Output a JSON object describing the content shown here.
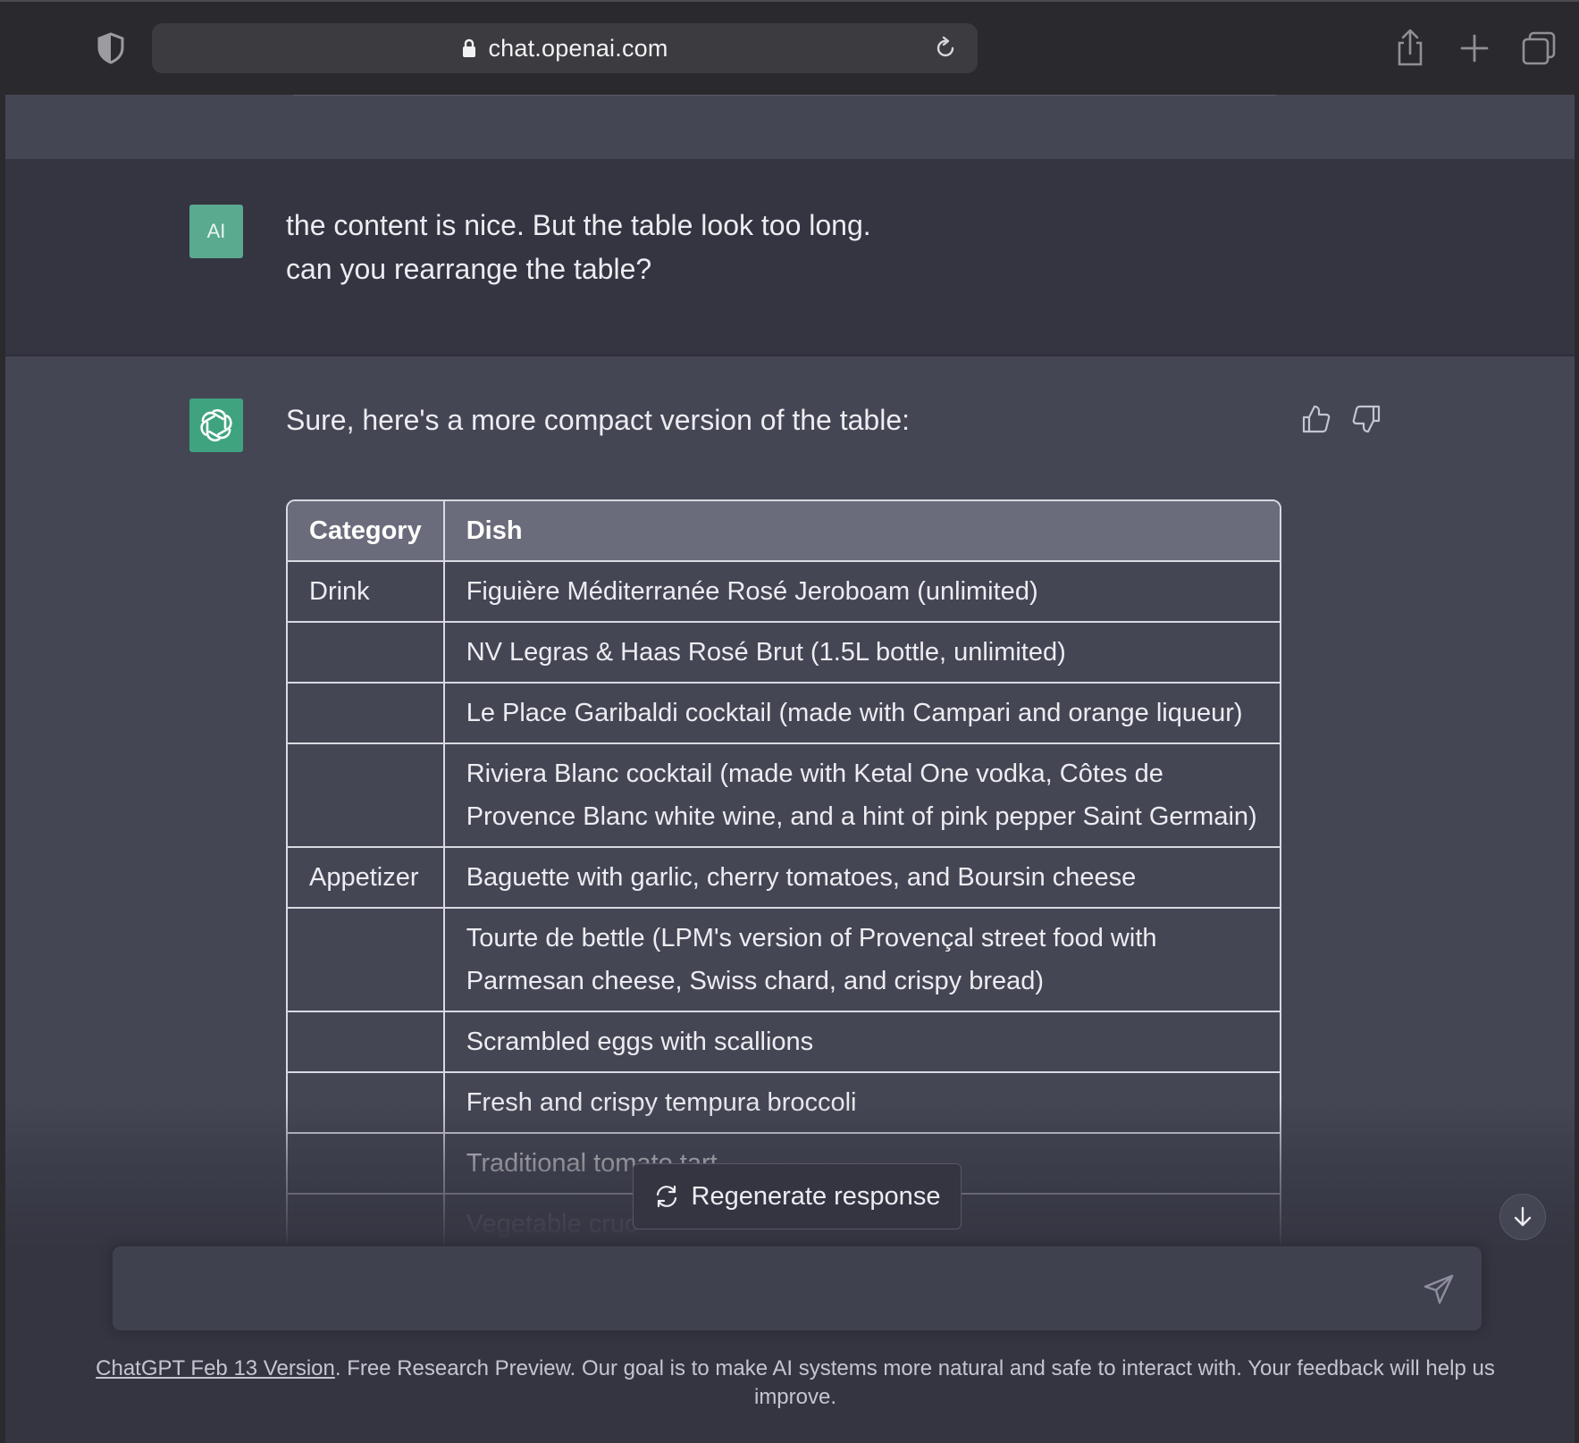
{
  "browser": {
    "url": "chat.openai.com"
  },
  "user_message": {
    "avatar_initials": "AI",
    "lines": [
      "the content is nice. But the table look too long.",
      "can you rearrange the table?"
    ]
  },
  "assistant_message": {
    "intro": "Sure, here's a more compact version of the table:",
    "table": {
      "headers": [
        "Category",
        "Dish"
      ],
      "rows": [
        {
          "category": "Drink",
          "dish": [
            "Figuière Méditerranée Rosé Jeroboam (unlimited)"
          ]
        },
        {
          "category": "",
          "dish": [
            "NV Legras & Haas Rosé Brut (1.5L bottle, unlimited)"
          ]
        },
        {
          "category": "",
          "dish": [
            "Le Place Garibaldi cocktail (made with Campari and orange liqueur)"
          ]
        },
        {
          "category": "",
          "dish": [
            "Riviera Blanc cocktail (made with Ketal One vodka, Côtes de",
            "Provence Blanc white wine, and a hint of pink pepper Saint Germain)"
          ]
        },
        {
          "category": "Appetizer",
          "dish": [
            "Baguette with garlic, cherry tomatoes, and Boursin cheese"
          ]
        },
        {
          "category": "",
          "dish": [
            "Tourte de bettle (LPM's version of Provençal street food with",
            "Parmesan cheese, Swiss chard, and crispy bread)"
          ]
        },
        {
          "category": "",
          "dish": [
            "Scrambled eggs with scallions"
          ]
        },
        {
          "category": "",
          "dish": [
            "Fresh and crispy tempura broccoli"
          ]
        },
        {
          "category": "",
          "dish": [
            "Traditional tomato tart"
          ]
        },
        {
          "category": "",
          "dish": [
            "Vegetable cruc"
          ]
        }
      ]
    }
  },
  "regenerate_label": "Regenerate response",
  "composer": {
    "placeholder": ""
  },
  "footer": {
    "link_text": "ChatGPT Feb 13 Version",
    "text": ". Free Research Preview. Our goal is to make AI systems more natural and safe to interact with. Your feedback will help us improve."
  },
  "icons": {
    "shield": "shield-icon",
    "lock": "lock-icon",
    "reload": "reload-icon",
    "share": "share-icon",
    "new_tab": "plus-icon",
    "tabs": "tabs-overview-icon",
    "openai": "openai-logo-icon",
    "thumbs_up": "thumbs-up-icon",
    "thumbs_down": "thumbs-down-icon",
    "regenerate": "refresh-icon",
    "scroll_down": "arrow-down-icon",
    "send": "send-icon"
  }
}
